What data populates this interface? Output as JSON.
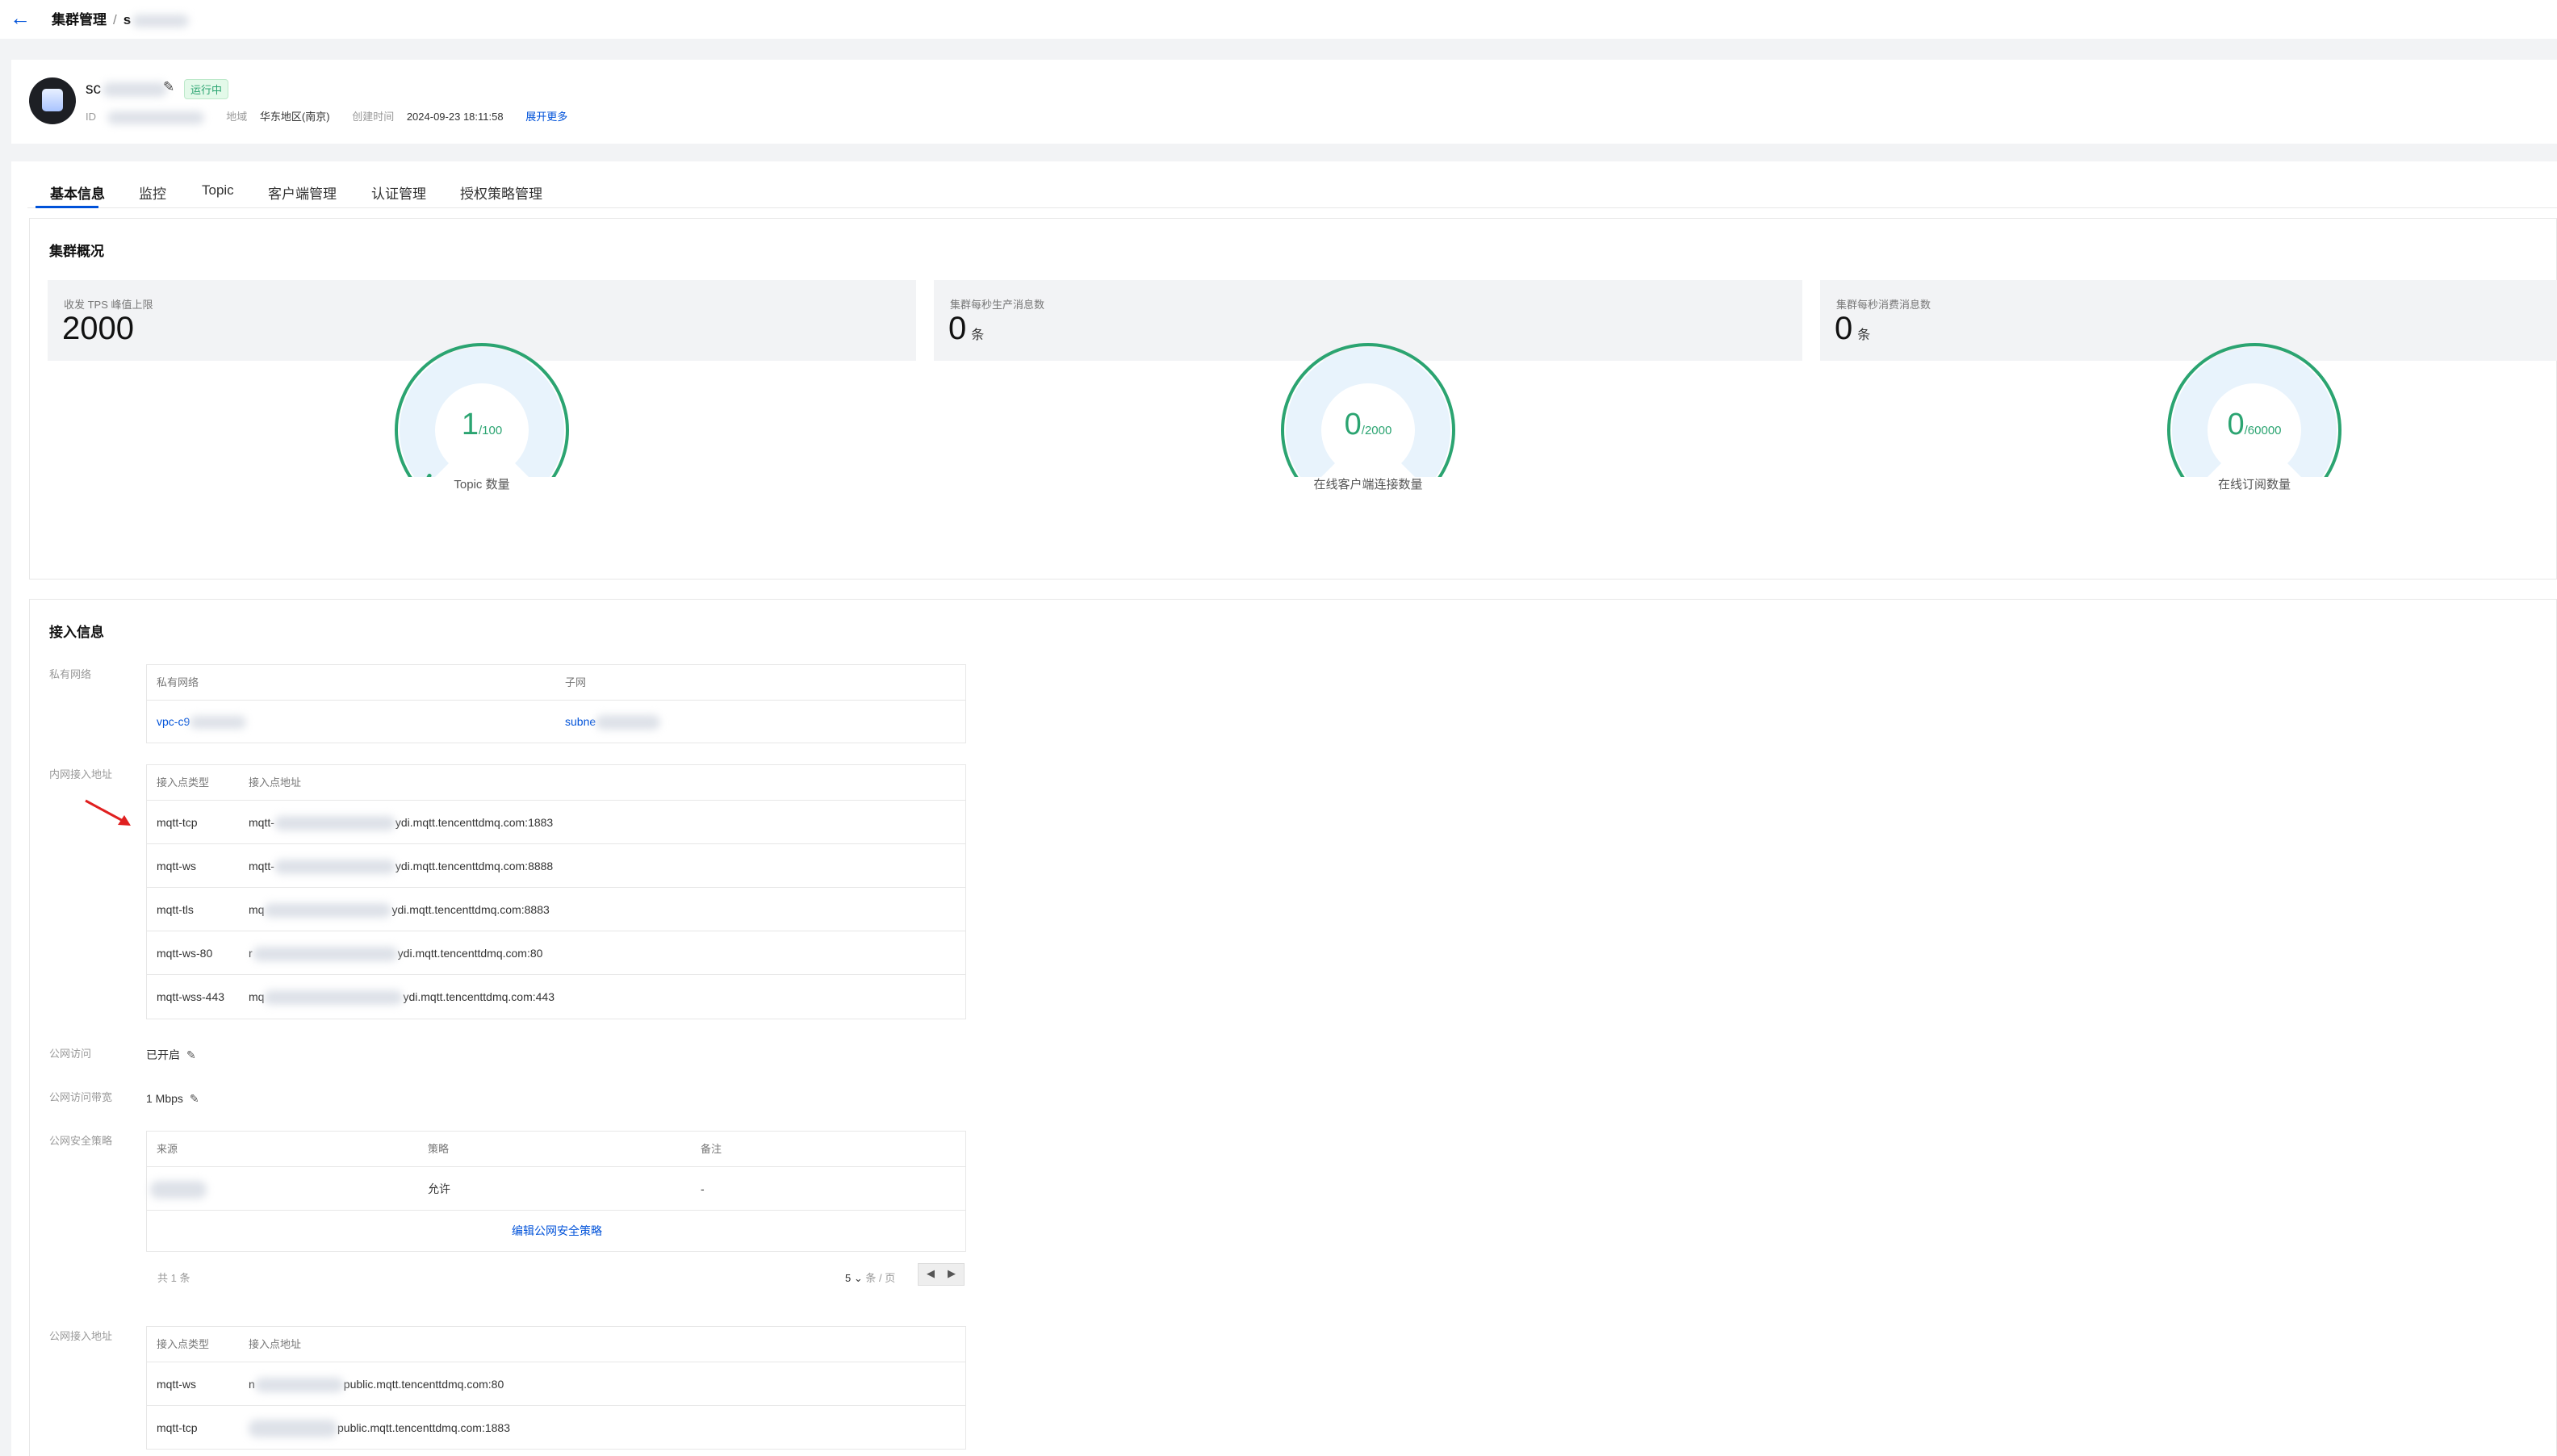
{
  "breadcrumb": {
    "parent": "集群管理",
    "separator": "/",
    "current": "s"
  },
  "header": {
    "name": "sc",
    "status": "运行中",
    "id_label": "ID",
    "region_label": "地域",
    "region_value": "华东地区(南京)",
    "created_label": "创建时间",
    "created_value": "2024-09-23 18:11:58",
    "expand_more": "展开更多",
    "icons": {
      "edit": "pencil-icon",
      "back": "arrow-left-icon"
    }
  },
  "tabs": [
    {
      "label": "基本信息",
      "active": true
    },
    {
      "label": "监控"
    },
    {
      "label": "Topic"
    },
    {
      "label": "客户端管理"
    },
    {
      "label": "认证管理"
    },
    {
      "label": "授权策略管理"
    }
  ],
  "overview": {
    "title": "集群概况",
    "stats": [
      {
        "label": "收发 TPS 峰值上限",
        "value": "2000",
        "unit": ""
      },
      {
        "label": "集群每秒生产消息数",
        "value": "0",
        "unit": "条"
      },
      {
        "label": "集群每秒消费消息数",
        "value": "0",
        "unit": "条"
      }
    ],
    "gauges": [
      {
        "value": "1",
        "max": "/100",
        "label": "Topic 数量",
        "fraction": 0.01
      },
      {
        "value": "0",
        "max": "/2000",
        "label": "在线客户端连接数量",
        "fraction": 0
      },
      {
        "value": "0",
        "max": "/60000",
        "label": "在线订阅数量",
        "fraction": 0
      }
    ]
  },
  "access": {
    "title": "接入信息",
    "vpc": {
      "label": "私有网络",
      "headers": [
        "私有网络",
        "子网"
      ],
      "vpc_value": "vpc-c9",
      "subnet_value": "subne"
    },
    "internal": {
      "label": "内网接入地址",
      "headers": [
        "接入点类型",
        "接入点地址"
      ],
      "rows": [
        {
          "type": "mqtt-tcp",
          "prefix": "mqtt-",
          "suffix": "ydi.mqtt.tencenttdmq.com:1883"
        },
        {
          "type": "mqtt-ws",
          "prefix": "mqtt-",
          "suffix": "ydi.mqtt.tencenttdmq.com:8888"
        },
        {
          "type": "mqtt-tls",
          "prefix": "mq",
          "suffix": "ydi.mqtt.tencenttdmq.com:8883"
        },
        {
          "type": "mqtt-ws-80",
          "prefix": "r",
          "suffix": "ydi.mqtt.tencenttdmq.com:80"
        },
        {
          "type": "mqtt-wss-443",
          "prefix": "mq",
          "suffix": "ydi.mqtt.tencenttdmq.com:443"
        }
      ]
    },
    "public_access": {
      "label": "公网访问",
      "value": "已开启"
    },
    "public_bandwidth": {
      "label": "公网访问带宽",
      "value": "1 Mbps"
    },
    "security": {
      "label": "公网安全策略",
      "headers": [
        "来源",
        "策略",
        "备注"
      ],
      "row": {
        "policy": "允许",
        "note": "-"
      },
      "edit_link": "编辑公网安全策略",
      "total": "共 1 条",
      "page_size": "5",
      "page_size_unit": "条 / 页"
    },
    "public_endpoints": {
      "label": "公网接入地址",
      "headers": [
        "接入点类型",
        "接入点地址"
      ],
      "rows": [
        {
          "type": "mqtt-ws",
          "prefix": "n",
          "suffix": "public.mqtt.tencenttdmq.com:80"
        },
        {
          "type": "mqtt-tcp",
          "prefix": "",
          "suffix": "public.mqtt.tencenttdmq.com:1883"
        }
      ]
    }
  },
  "colors": {
    "accent": "#0052d9",
    "success": "#2ba471",
    "gauge_track": "#e8f3fc"
  }
}
